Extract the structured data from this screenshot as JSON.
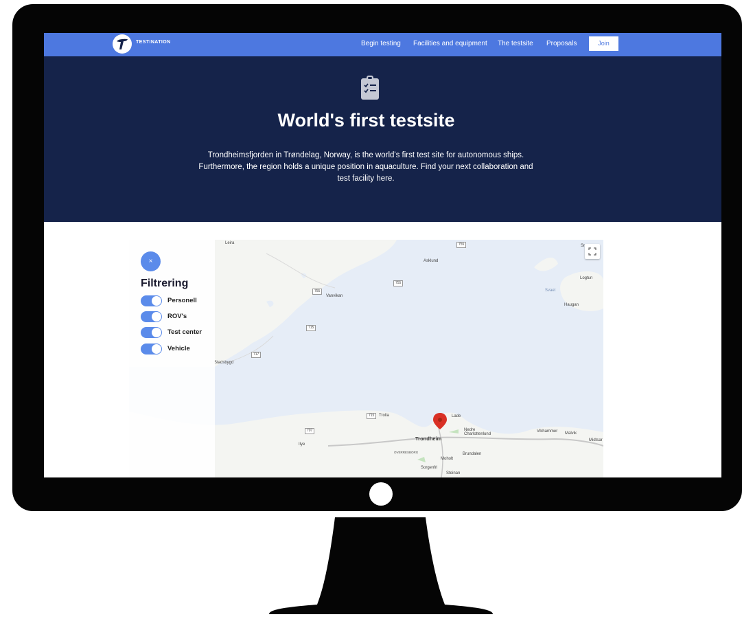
{
  "nav": {
    "logo_text": "TESTINATION",
    "links": [
      "Begin testing",
      "Facilities and equipment",
      "The testsite",
      "Proposals"
    ],
    "join_label": "Join"
  },
  "hero": {
    "icon": "clipboard-check-icon",
    "title": "World's first testsite",
    "description": "Trondheimsfjorden in Trøndelag, Norway, is the world's first test site for autonomous ships. Furthermore, the region holds a unique position in aquaculture. Find your next collaboration and test facility here."
  },
  "filter": {
    "close_label": "×",
    "title": "Filtrering",
    "items": [
      {
        "label": "Personell",
        "on": true
      },
      {
        "label": "ROV's",
        "on": true
      },
      {
        "label": "Test center",
        "on": true
      },
      {
        "label": "Vehicle",
        "on": true
      }
    ]
  },
  "map": {
    "places": [
      "Leira",
      "Asklund",
      "Vanvikan",
      "Logtun",
      "Svaet",
      "Haugan",
      "Stadsbygd",
      "Trolla",
      "Lade",
      "Trondheim",
      "Nedre Charlottenlund",
      "Vikhammer",
      "Malvik",
      "Midtsar",
      "Ilye",
      "OVERRESBORG",
      "Brundalen",
      "Moholt",
      "Sorgenfri",
      "Steinan",
      "Sr"
    ],
    "road_numbers": [
      "755",
      "755",
      "755",
      "715",
      "717",
      "715",
      "707"
    ],
    "colors": {
      "water": "#e6edf7",
      "land": "#f4f5f2",
      "marker": "#d93025"
    }
  },
  "colors": {
    "nav": "#4d78e0",
    "hero": "#15234a",
    "toggle": "#5b8bea"
  }
}
